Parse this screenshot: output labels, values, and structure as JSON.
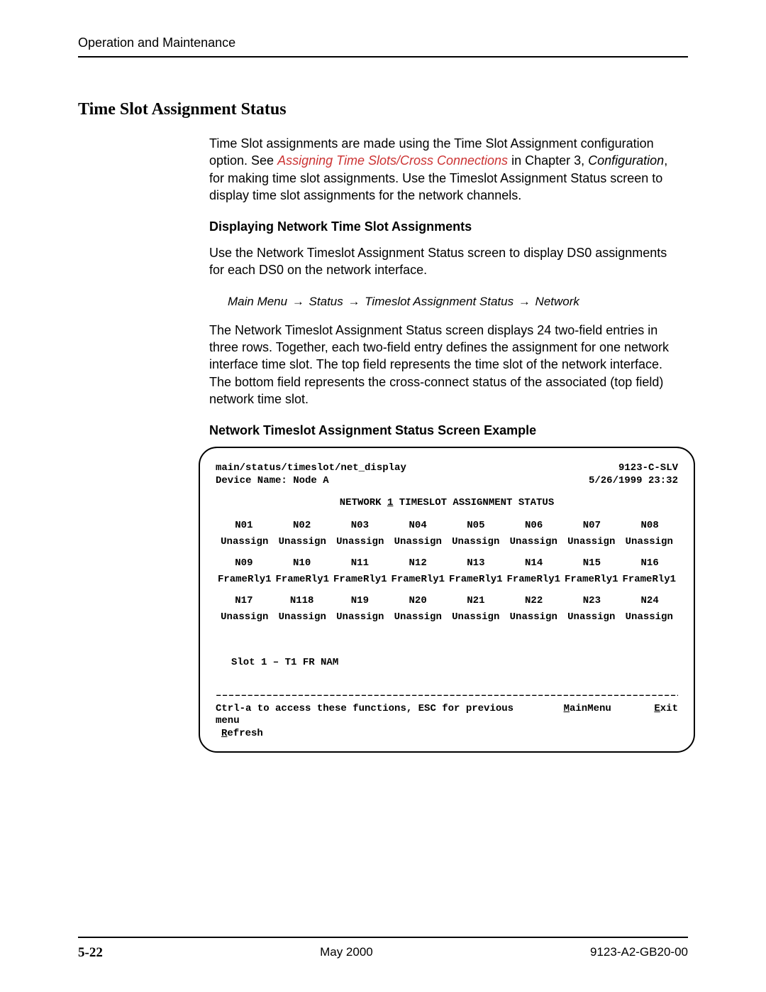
{
  "header": "Operation and Maintenance",
  "section_title": "Time Slot Assignment Status",
  "intro_a": "Time Slot assignments are made using the Time Slot Assignment configuration option. See ",
  "intro_link": "Assigning Time Slots/Cross Connections",
  "intro_b": " in Chapter 3, ",
  "intro_c": "Configuration",
  "intro_d": ", for making time slot assignments. Use the Timeslot Assignment Status screen to display time slot assignments for the network channels.",
  "sub1_title": "Displaying Network Time Slot Assignments",
  "sub1_para1": "Use the Network Timeslot Assignment Status screen to display DS0 assignments for each DS0 on the network interface.",
  "nav": {
    "a": "Main Menu ",
    "b": " Status ",
    "c": " Timeslot Assignment Status ",
    "d": " Network"
  },
  "sub1_para2": "The Network Timeslot Assignment Status screen displays 24 two-field entries in three rows. Together, each two-field entry defines the assignment for one network interface time slot. The top field represents the time slot of the network interface. The bottom field represents the cross-connect status of the associated (top field) network time slot.",
  "screen_title": "Network Timeslot Assignment Status Screen Example",
  "terminal": {
    "path": "main/status/timeslot/net_display",
    "model": "9123-C-SLV",
    "device_label": "Device Name: Node A",
    "datetime": "5/26/1999 23:32",
    "title_a": "NETWORK ",
    "title_num": "1",
    "title_b": " TIMESLOT ASSIGNMENT STATUS",
    "row1_slots": [
      "N01",
      "N02",
      "N03",
      "N04",
      "N05",
      "N06",
      "N07",
      "N08"
    ],
    "row1_assign": [
      "Unassign",
      "Unassign",
      "Unassign",
      "Unassign",
      "Unassign",
      "Unassign",
      "Unassign",
      "Unassign"
    ],
    "row2_slots": [
      "N09",
      "N10",
      "N11",
      "N12",
      "N13",
      "N14",
      "N15",
      "N16"
    ],
    "row2_assign": [
      "FrameRly1",
      "FrameRly1",
      "FrameRly1",
      "FrameRly1",
      "FrameRly1",
      "FrameRly1",
      "FrameRly1",
      "FrameRly1"
    ],
    "row3_slots": [
      "N17",
      "N118",
      "N19",
      "N20",
      "N21",
      "N22",
      "N23",
      "N24"
    ],
    "row3_assign": [
      "Unassign",
      "Unassign",
      "Unassign",
      "Unassign",
      "Unassign",
      "Unassign",
      "Unassign",
      "Unassign"
    ],
    "slot_info": "Slot 1 – T1 FR NAM",
    "dashes": "––––––––––––––––––––––––––––––––––––––––––––––––––––––––––––––––––––––––––––––––",
    "footer_msg": "Ctrl-a to access these functions, ESC for previous menu",
    "refresh_u": "R",
    "refresh_rest": "efresh",
    "mainmenu_u": "M",
    "mainmenu_rest": "ainMenu",
    "exit_u": "E",
    "exit_rest": "xit"
  },
  "footer": {
    "page": "5-22",
    "date": "May 2000",
    "doc": "9123-A2-GB20-00"
  }
}
